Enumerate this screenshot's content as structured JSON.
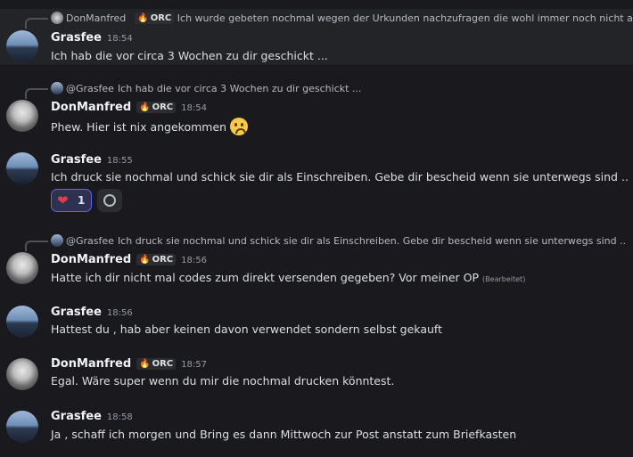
{
  "messages": [
    {
      "reply": {
        "name": "DonManfred",
        "tag": "ORC",
        "text": "Ich wurde gebeten nochmal wegen der Urkunden nachzufragen die wohl immer noch nicht angeko"
      },
      "author": "Grasfee",
      "time": "18:54",
      "text": "Ich hab die vor circa 3 Wochen zu dir geschickt ..."
    },
    {
      "reply": {
        "name": "@Grasfee",
        "text": "Ich hab die vor circa 3 Wochen zu dir geschickt ..."
      },
      "author": "DonManfred",
      "tag": "ORC",
      "time": "18:54",
      "text": "Phew. Hier ist nix angekommen",
      "emoji": "frowning-face"
    },
    {
      "author": "Grasfee",
      "time": "18:55",
      "text": "Ich druck sie nochmal und schick sie dir als Einschreiben. Gebe dir bescheid wenn sie unterwegs sind ..",
      "reaction": {
        "emoji": "heart",
        "count": "1"
      }
    },
    {
      "reply": {
        "name": "@Grasfee",
        "text": "Ich druck sie nochmal und schick sie dir als Einschreiben. Gebe dir bescheid wenn sie unterwegs sind .."
      },
      "author": "DonManfred",
      "tag": "ORC",
      "time": "18:56",
      "text": "Hatte ich dir nicht mal codes zum direkt versenden gegeben? Vor meiner OP",
      "edited": "(Bearbeitet)"
    },
    {
      "author": "Grasfee",
      "time": "18:56",
      "text": "Hattest du , hab aber keinen davon verwendet sondern selbst gekauft"
    },
    {
      "author": "DonManfred",
      "tag": "ORC",
      "time": "18:57",
      "text": "Egal. Wäre super wenn du mir die nochmal drucken könntest."
    },
    {
      "author": "Grasfee",
      "time": "18:58",
      "text": "Ja , schaff ich morgen und Bring es dann Mittwoch zur Post anstatt zum Briefkasten"
    }
  ]
}
